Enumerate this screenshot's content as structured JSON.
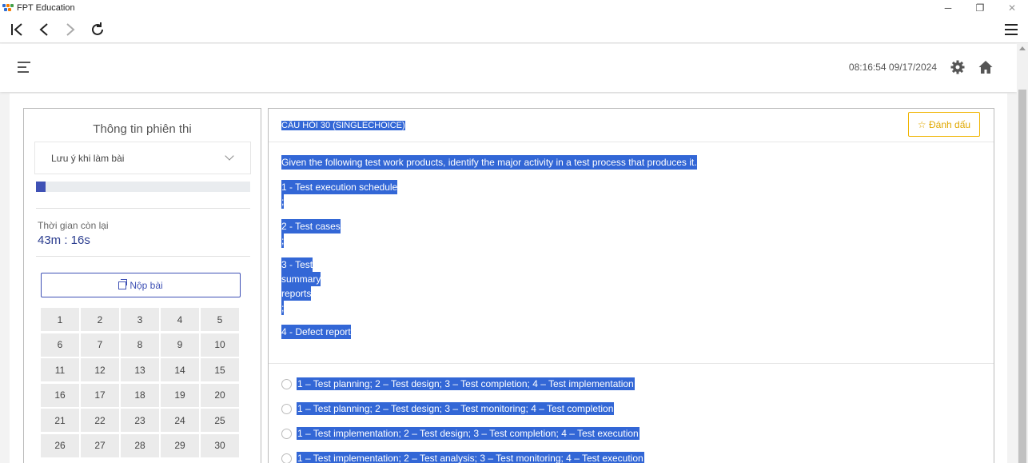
{
  "window": {
    "title": "FPT Education",
    "controls": {
      "minimize": "─",
      "restore": "❐",
      "close": "✕"
    }
  },
  "header": {
    "datetime": "08:16:54 09/17/2024"
  },
  "left_panel": {
    "title": "Thông tin phiên thi",
    "notes_dropdown": "Lưu ý khi làm bài",
    "progress_fraction": 0.045,
    "time_label": "Thời gian còn lại",
    "time_value": "43m : 16s",
    "submit_label": "Nộp bài",
    "questions": [
      "1",
      "2",
      "3",
      "4",
      "5",
      "6",
      "7",
      "8",
      "9",
      "10",
      "11",
      "12",
      "13",
      "14",
      "15",
      "16",
      "17",
      "18",
      "19",
      "20",
      "21",
      "22",
      "23",
      "24",
      "25",
      "26",
      "27",
      "28",
      "29",
      "30"
    ]
  },
  "question": {
    "header": "CÂU HỎI 30 (SINGLECHOICE)",
    "mark_label": "☆ Đánh dấu",
    "lines": [
      "Given the following test work products, identify the major activity in a test process that produces it.",
      "1 - Test execution schedule",
      ";",
      "2 - Test cases",
      ";",
      "3 - Test",
      "summary",
      "reports",
      ";",
      "4 - Defect report"
    ],
    "answers": [
      "1 – Test planning; 2 – Test design; 3 – Test completion; 4 – Test implementation",
      "1 – Test planning; 2 – Test design; 3 – Test monitoring; 4 – Test completion",
      "1 – Test implementation; 2 – Test design; 3 – Test completion; 4 – Test execution",
      "1 – Test implementation; 2 – Test analysis; 3 – Test monitoring; 4 – Test execution"
    ]
  },
  "colors": {
    "accent": "#3f51b5",
    "highlight": "#3367d6",
    "mark": "#f0b400",
    "time": "#2b3d8f"
  },
  "icons": [
    "back-to-start-icon",
    "back-icon",
    "forward-icon",
    "reload-icon",
    "menu-icon",
    "hamburger-icon",
    "gear-icon",
    "home-icon",
    "chevron-down-icon",
    "submit-icon",
    "radio-icon"
  ]
}
